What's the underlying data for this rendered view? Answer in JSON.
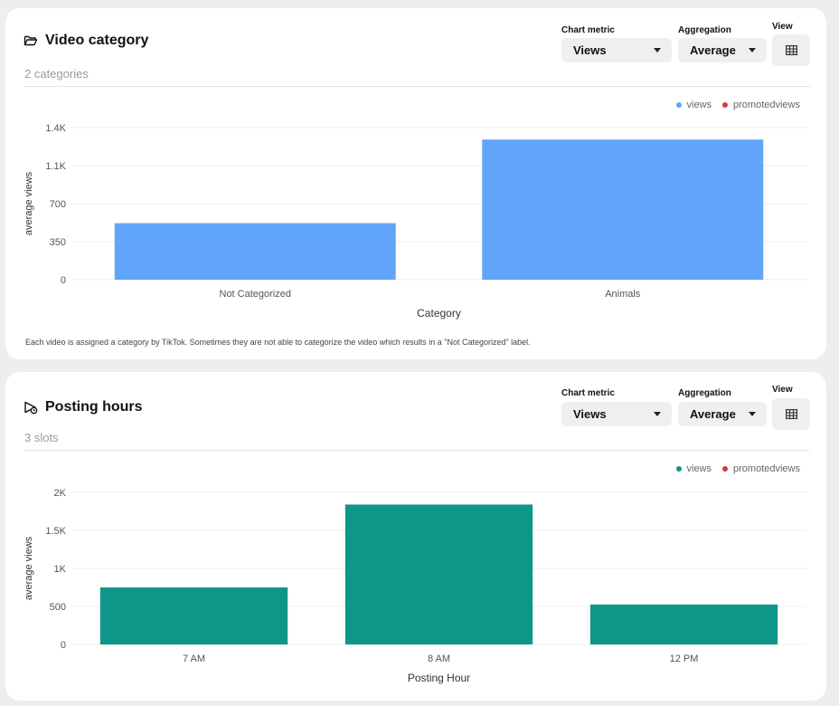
{
  "cards": [
    {
      "title": "Video category",
      "icon": "folder-open-icon",
      "subtitle": "2 categories",
      "controls": {
        "chart_metric_label": "Chart metric",
        "chart_metric_value": "Views",
        "aggregation_label": "Aggregation",
        "aggregation_value": "Average",
        "view_label": "View",
        "view_icon": "table-grid-icon"
      },
      "legend": [
        {
          "name": "views",
          "color": "#60a5fa"
        },
        {
          "name": "promotedviews",
          "color": "#d13c3c"
        }
      ],
      "footnote": "Each video is assigned a category by TikTok. Sometimes they are not able to categorize the video which results in a \"Not Categorized\" label."
    },
    {
      "title": "Posting hours",
      "icon": "clock-play-icon",
      "subtitle": "3 slots",
      "controls": {
        "chart_metric_label": "Chart metric",
        "chart_metric_value": "Views",
        "aggregation_label": "Aggregation",
        "aggregation_value": "Average",
        "view_label": "View",
        "view_icon": "table-grid-icon"
      },
      "legend": [
        {
          "name": "views",
          "color": "#0e9688"
        },
        {
          "name": "promotedviews",
          "color": "#d13c3c"
        }
      ]
    }
  ],
  "chart_data": [
    {
      "type": "bar",
      "categories": [
        "Not Categorized",
        "Animals"
      ],
      "series": [
        {
          "name": "views",
          "values": [
            520,
            1290
          ],
          "color": "#60a5fa"
        }
      ],
      "xlabel": "Category",
      "ylabel": "average views",
      "ylim": [
        0,
        1400
      ],
      "yticks": [
        0,
        350,
        700,
        1050,
        1400
      ],
      "ytick_labels": [
        "0",
        "350",
        "700",
        "1.1K",
        "1.4K"
      ],
      "grid": true,
      "legend_position": "top-right"
    },
    {
      "type": "bar",
      "categories": [
        "7 AM",
        "8 AM",
        "12 PM"
      ],
      "series": [
        {
          "name": "views",
          "values": [
            750,
            1840,
            525
          ],
          "color": "#0e9688"
        }
      ],
      "xlabel": "Posting Hour",
      "ylabel": "average views",
      "ylim": [
        0,
        2000
      ],
      "yticks": [
        0,
        500,
        1000,
        1500,
        2000
      ],
      "ytick_labels": [
        "0",
        "500",
        "1K",
        "1.5K",
        "2K"
      ],
      "grid": true,
      "legend_position": "top-right"
    }
  ]
}
